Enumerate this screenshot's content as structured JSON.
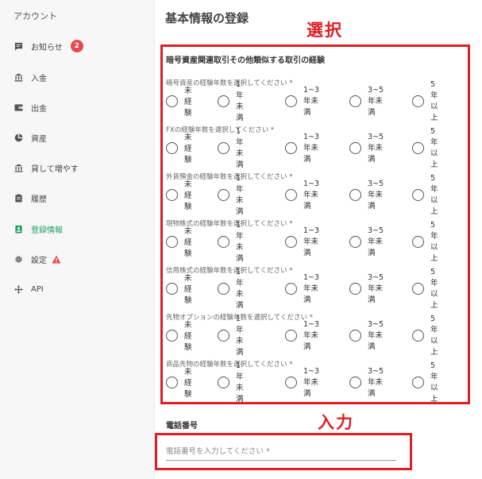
{
  "sidebar": {
    "title": "アカウント",
    "items": [
      {
        "label": "お知らせ",
        "icon": "message-icon",
        "badge": "2"
      },
      {
        "label": "入金",
        "icon": "bank-icon"
      },
      {
        "label": "出金",
        "icon": "wallet-icon"
      },
      {
        "label": "資産",
        "icon": "pie-chart-icon"
      },
      {
        "label": "貸して増やす",
        "icon": "bank-icon"
      },
      {
        "label": "履歴",
        "icon": "clipboard-icon"
      },
      {
        "label": "登録情報",
        "icon": "id-card-icon",
        "active": true
      },
      {
        "label": "設定",
        "icon": "gear-icon",
        "warning": true
      },
      {
        "label": "API",
        "icon": "move-icon"
      }
    ],
    "active_color": "#1e9c6a",
    "badge_color": "#e24b4b"
  },
  "main": {
    "title": "基本情報の登録",
    "annotation_select": "選択",
    "annotation_input": "入力",
    "annotation_color": "#e01e26",
    "section_title": "暗号資産関連取引その他類似する取引の経験",
    "options": [
      "未経験",
      "1年未満",
      "1~3年未満",
      "3~5年未満",
      "5年以上"
    ],
    "questions": [
      "暗号資産の経験年数を選択してください *",
      "FXの経験年数を選択してください *",
      "外貨預金の経験年数を選択してください *",
      "現物株式の経験年数を選択してください *",
      "信用株式の経験年数を選択してください *",
      "先物オプションの経験年数を選択してください *",
      "商品先物の経験年数を選択してください *"
    ],
    "phone": {
      "label": "電話番号",
      "placeholder": "電話番号を入力してください *",
      "value": ""
    }
  }
}
